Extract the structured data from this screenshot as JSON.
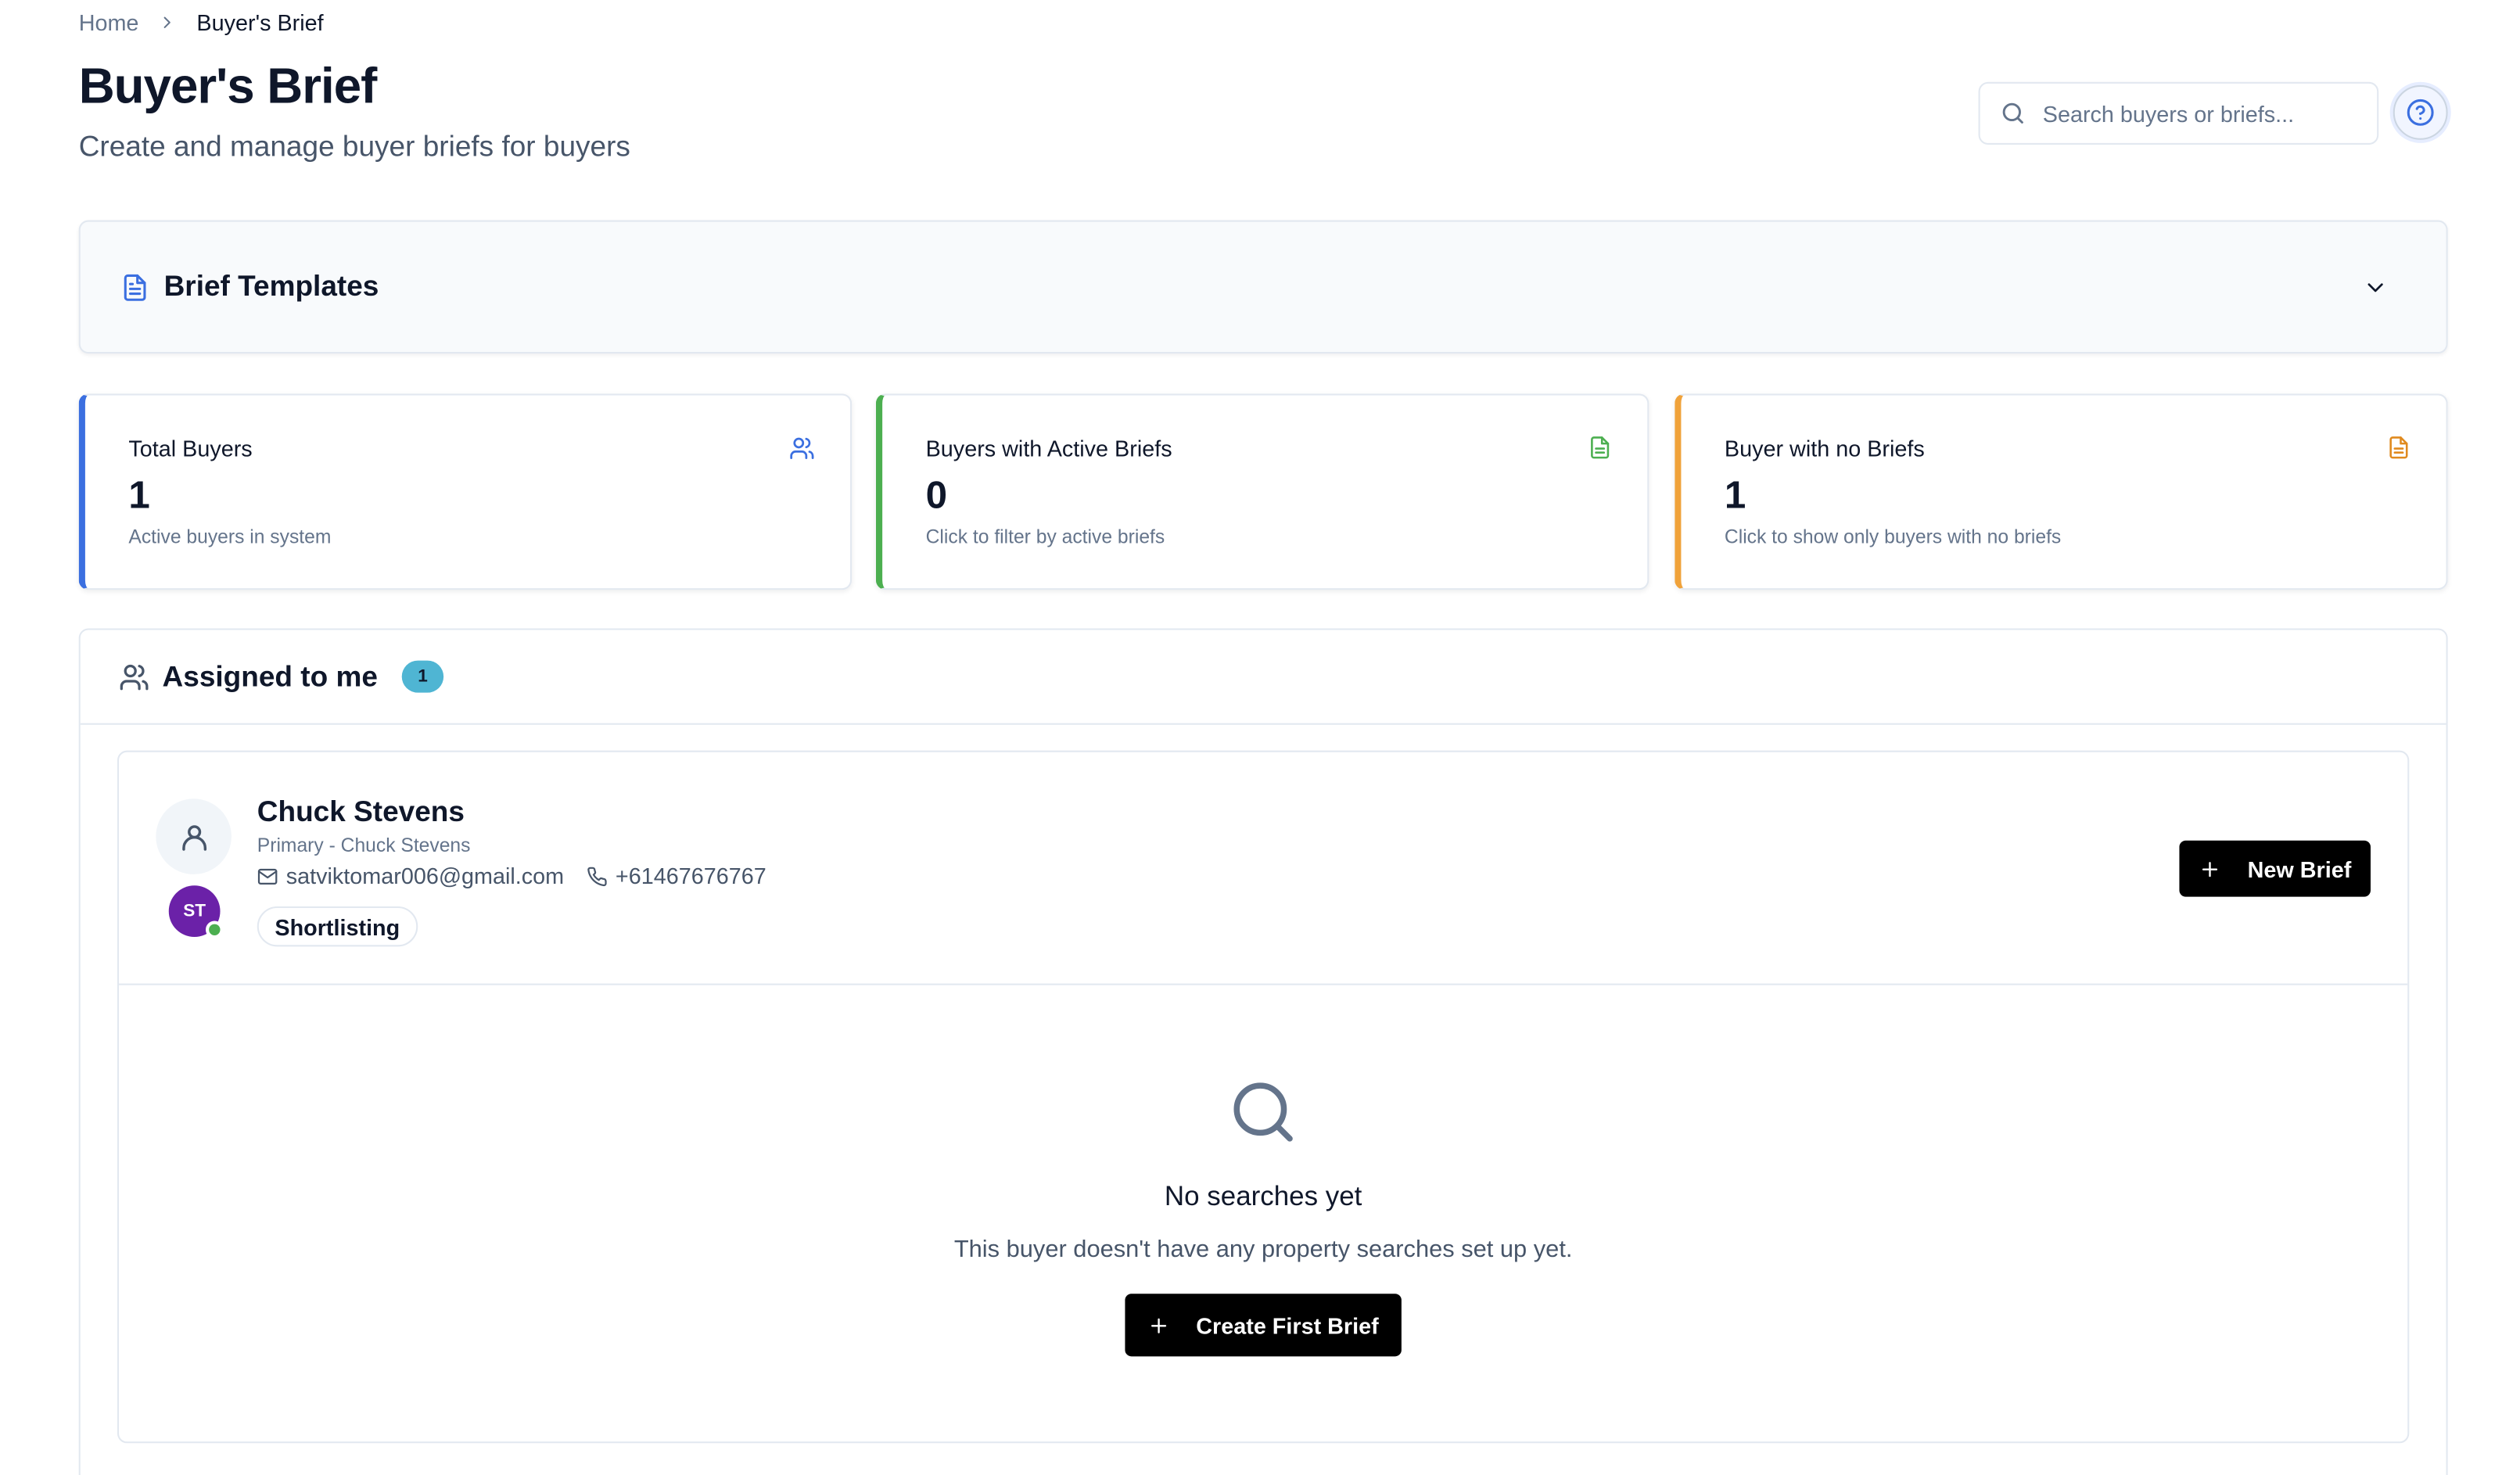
{
  "breadcrumb": {
    "home": "Home",
    "current": "Buyer's Brief"
  },
  "header": {
    "title": "Buyer's Brief",
    "subtitle": "Create and manage buyer briefs for buyers",
    "search_placeholder": "Search buyers or briefs..."
  },
  "templates": {
    "title": "Brief Templates"
  },
  "stats": [
    {
      "label": "Total Buyers",
      "value": "1",
      "hint": "Active buyers in system",
      "icon": "users-icon",
      "accent": "#3b6fe0"
    },
    {
      "label": "Buyers with Active Briefs",
      "value": "0",
      "hint": "Click to filter by active briefs",
      "icon": "file-text-icon",
      "accent": "#4caf50"
    },
    {
      "label": "Buyer with no Briefs",
      "value": "1",
      "hint": "Click to show only buyers with no briefs",
      "icon": "file-text-icon",
      "accent": "#f0a23a"
    }
  ],
  "assigned": {
    "title": "Assigned to me",
    "count": "1",
    "buyer": {
      "name": "Chuck Stevens",
      "role": "Primary - Chuck Stevens",
      "email": "satviktomar006@gmail.com",
      "phone": "+61467676767",
      "initials": "ST",
      "status": "Shortlisting",
      "new_brief_label": "New Brief"
    },
    "empty": {
      "title": "No searches yet",
      "description": "This buyer doesn't have any property searches set up yet.",
      "cta_label": "Create First Brief"
    }
  },
  "colors": {
    "accent_blue": "#3b6fe0",
    "accent_green": "#4caf50",
    "accent_orange": "#f0a23a",
    "badge": "#4fb5d3",
    "avatar": "#6b21a8"
  }
}
